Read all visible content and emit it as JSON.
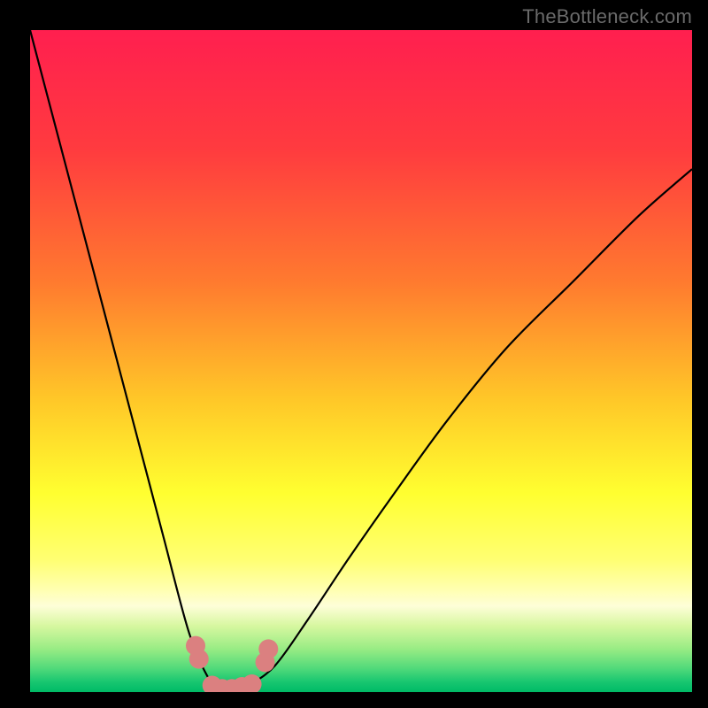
{
  "watermark": "TheBottleneck.com",
  "chart_data": {
    "type": "line",
    "title": "",
    "xlabel": "",
    "ylabel": "",
    "xlim": [
      0,
      100
    ],
    "ylim": [
      0,
      100
    ],
    "grid": false,
    "legend": false,
    "series": [
      {
        "name": "bottleneck-curve",
        "x": [
          0,
          5,
          10,
          15,
          20,
          24,
          27,
          29,
          31,
          33,
          37,
          42,
          48,
          55,
          63,
          72,
          82,
          92,
          100
        ],
        "values": [
          100,
          81,
          62,
          43,
          24,
          9,
          2,
          0,
          0,
          1,
          4,
          11,
          20,
          30,
          41,
          52,
          62,
          72,
          79
        ]
      }
    ],
    "markers": {
      "name": "highlight-points",
      "color": "#db8080",
      "points": [
        {
          "x": 25.0,
          "y": 7.0
        },
        {
          "x": 25.5,
          "y": 5.0
        },
        {
          "x": 27.5,
          "y": 1.0
        },
        {
          "x": 29.0,
          "y": 0.5
        },
        {
          "x": 30.5,
          "y": 0.5
        },
        {
          "x": 32.0,
          "y": 0.8
        },
        {
          "x": 33.5,
          "y": 1.2
        },
        {
          "x": 35.5,
          "y": 4.5
        },
        {
          "x": 36.0,
          "y": 6.5
        }
      ]
    },
    "gradient_stops": [
      {
        "pos": 0.0,
        "color": "#ff1f4f"
      },
      {
        "pos": 0.18,
        "color": "#ff3b3f"
      },
      {
        "pos": 0.38,
        "color": "#ff7a2f"
      },
      {
        "pos": 0.56,
        "color": "#ffc828"
      },
      {
        "pos": 0.7,
        "color": "#ffff30"
      },
      {
        "pos": 0.8,
        "color": "#ffff72"
      },
      {
        "pos": 0.845,
        "color": "#ffffb0"
      },
      {
        "pos": 0.87,
        "color": "#fefed8"
      },
      {
        "pos": 0.9,
        "color": "#d7f7a0"
      },
      {
        "pos": 0.935,
        "color": "#98ec84"
      },
      {
        "pos": 0.965,
        "color": "#4fd97a"
      },
      {
        "pos": 0.985,
        "color": "#17c670"
      },
      {
        "pos": 1.0,
        "color": "#00bb66"
      }
    ]
  }
}
